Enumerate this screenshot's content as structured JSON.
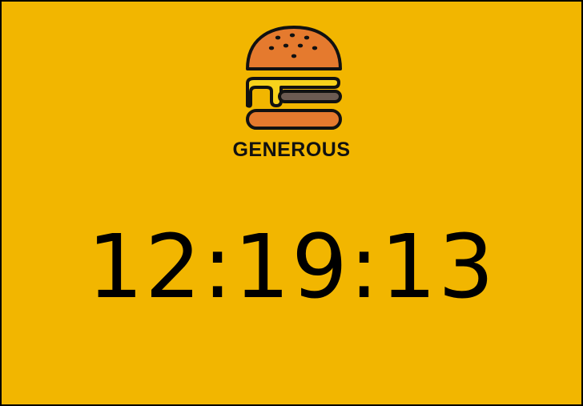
{
  "brand": {
    "name": "GENEROUS",
    "logo_icon": "burger-icon"
  },
  "clock": {
    "time": "12:19:13"
  },
  "colors": {
    "background": "#F2B600",
    "bun": "#E57A2E",
    "cheese": "#F7D21C",
    "patty": "#6B5A52",
    "outline": "#111111"
  }
}
